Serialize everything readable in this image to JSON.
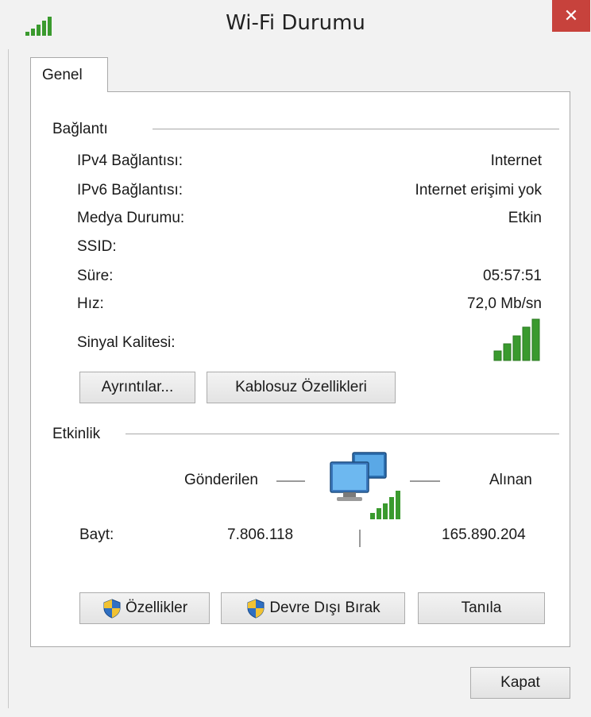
{
  "window": {
    "title": "Wi-Fi Durumu",
    "close_symbol": "✕"
  },
  "tabs": [
    {
      "label": "Genel"
    }
  ],
  "connection": {
    "group_label": "Bağlantı",
    "rows": [
      {
        "label": "IPv4 Bağlantısı:",
        "value": "Internet"
      },
      {
        "label": "IPv6 Bağlantısı:",
        "value": "Internet erişimi yok"
      },
      {
        "label": "Medya Durumu:",
        "value": "Etkin"
      },
      {
        "label": "SSID:",
        "value": ""
      },
      {
        "label": "Süre:",
        "value": "05:57:51"
      },
      {
        "label": "Hız:",
        "value": "72,0 Mb/sn"
      },
      {
        "label": "Sinyal Kalitesi:",
        "value": ""
      }
    ],
    "signal_bars_lit": 5,
    "signal_bars_total": 5,
    "details_button": "Ayrıntılar...",
    "wireless_props_button": "Kablosuz Özellikleri"
  },
  "activity": {
    "group_label": "Etkinlik",
    "sent_label": "Gönderilen",
    "received_label": "Alınan",
    "bytes_label": "Bayt:",
    "bytes_sent": "7.806.118",
    "bytes_received": "165.890.204"
  },
  "actions": {
    "properties_button": "Özellikler",
    "disable_button": "Devre Dışı Bırak",
    "diagnose_button": "Tanıla"
  },
  "footer": {
    "close_button": "Kapat"
  },
  "colors": {
    "signal_green": "#3a9a2e",
    "close_red": "#c7423c",
    "border": "#a9a9a9"
  },
  "icons": {
    "title": "wifi-signal-icon",
    "signal": "signal-strength-icon",
    "network": "network-computers-icon",
    "shield": "uac-shield-icon"
  }
}
